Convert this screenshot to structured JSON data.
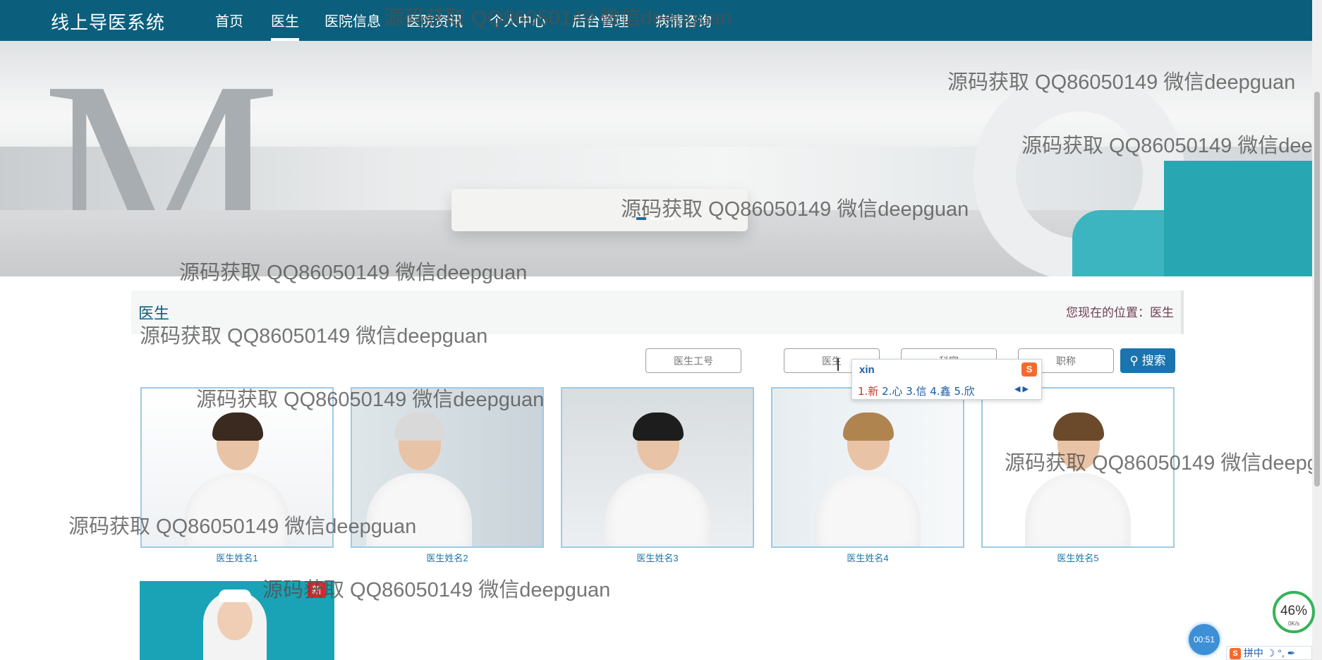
{
  "brand": "线上导医系统",
  "nav": [
    {
      "label": "首页",
      "active": false
    },
    {
      "label": "医生",
      "active": true
    },
    {
      "label": "医院信息",
      "active": false
    },
    {
      "label": "医院资讯",
      "active": false
    },
    {
      "label": "个人中心",
      "active": false
    },
    {
      "label": "后台管理",
      "active": false
    },
    {
      "label": "病情咨询",
      "active": false
    }
  ],
  "section": {
    "title": "医生",
    "breadcrumb": "您现在的位置：医生"
  },
  "search": {
    "doctor_id_placeholder": "医生工号",
    "doctor_name_placeholder": "医生",
    "department_placeholder": "科室",
    "title_placeholder": "职称",
    "button_label": "搜索"
  },
  "ime": {
    "input": "xin",
    "candidates": [
      "1.新",
      "2.心",
      "3.信",
      "4.鑫",
      "5.欣"
    ]
  },
  "doctors": [
    {
      "name": "医生姓名1"
    },
    {
      "name": "医生姓名2"
    },
    {
      "name": "医生姓名3"
    },
    {
      "name": "医生姓名4"
    },
    {
      "name": "医生姓名5"
    }
  ],
  "watermark_text": "源码获取 QQ86050149 微信deepguan",
  "card6_badge": "新",
  "overlay": {
    "speed_percent": "46%",
    "speed_rate": "0K/s",
    "timer": "00:51",
    "ime_status": "拼中"
  }
}
